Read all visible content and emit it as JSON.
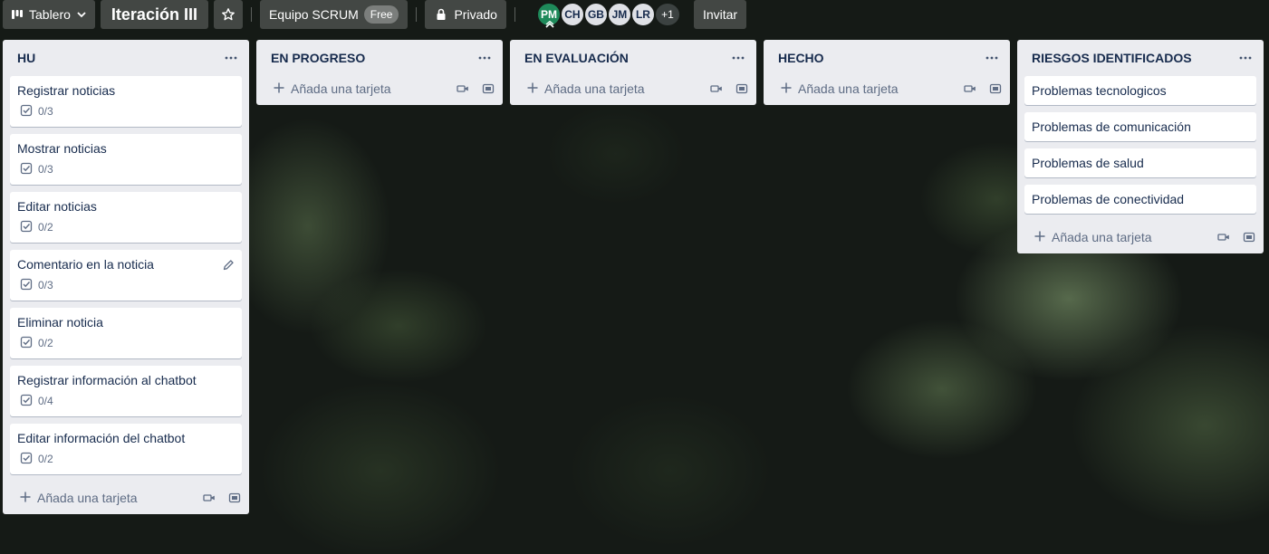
{
  "header": {
    "view_label": "Tablero",
    "board_title": "Iteración III",
    "team_label": "Equipo SCRUM",
    "plan_badge": "Free",
    "visibility_label": "Privado",
    "members": [
      "PM",
      "CH",
      "GB",
      "JM",
      "LR"
    ],
    "more_members": "+1",
    "invite_label": "Invitar"
  },
  "lists": [
    {
      "title": "HU",
      "menu": "...",
      "add_card": "Añada una tarjeta",
      "cards": [
        {
          "title": "Registrar noticias",
          "checklist": "0/3"
        },
        {
          "title": "Mostrar noticias",
          "checklist": "0/3"
        },
        {
          "title": "Editar noticias",
          "checklist": "0/2"
        },
        {
          "title": "Comentario en la noticia",
          "checklist": "0/3"
        },
        {
          "title": "Eliminar noticia",
          "checklist": "0/2"
        },
        {
          "title": "Registrar información al chatbot",
          "checklist": "0/4"
        },
        {
          "title": "Editar información del chatbot",
          "checklist": "0/2"
        }
      ]
    },
    {
      "title": "EN PROGRESO",
      "menu": "...",
      "add_card": "Añada una tarjeta",
      "cards": []
    },
    {
      "title": "EN EVALUACIÓN",
      "menu": "...",
      "add_card": "Añada una tarjeta",
      "cards": []
    },
    {
      "title": "HECHO",
      "menu": "...",
      "add_card": "Añada una tarjeta",
      "cards": []
    },
    {
      "title": "RIESGOS IDENTIFICADOS",
      "menu": "...",
      "add_card": "Añada una tarjeta",
      "cards": [
        {
          "title": "Problemas tecnologicos"
        },
        {
          "title": "Problemas de comunicación"
        },
        {
          "title": "Problemas de salud"
        },
        {
          "title": "Problemas de conectividad"
        }
      ]
    }
  ],
  "icons": {
    "view": "board-icon",
    "chevron": "chevron-down-icon",
    "star": "star-icon",
    "lock": "lock-icon",
    "menu": "more-horizontal-icon",
    "checklist": "checklist-icon",
    "add": "plus-icon",
    "video": "video-icon",
    "template": "template-icon",
    "edit": "pencil-icon"
  },
  "colors": {
    "list_background": "#ebecf0",
    "card_background": "#ffffff",
    "text": "#172b4d",
    "muted_text": "#5e6c84",
    "avatar_pm": "#1e8a5a"
  }
}
